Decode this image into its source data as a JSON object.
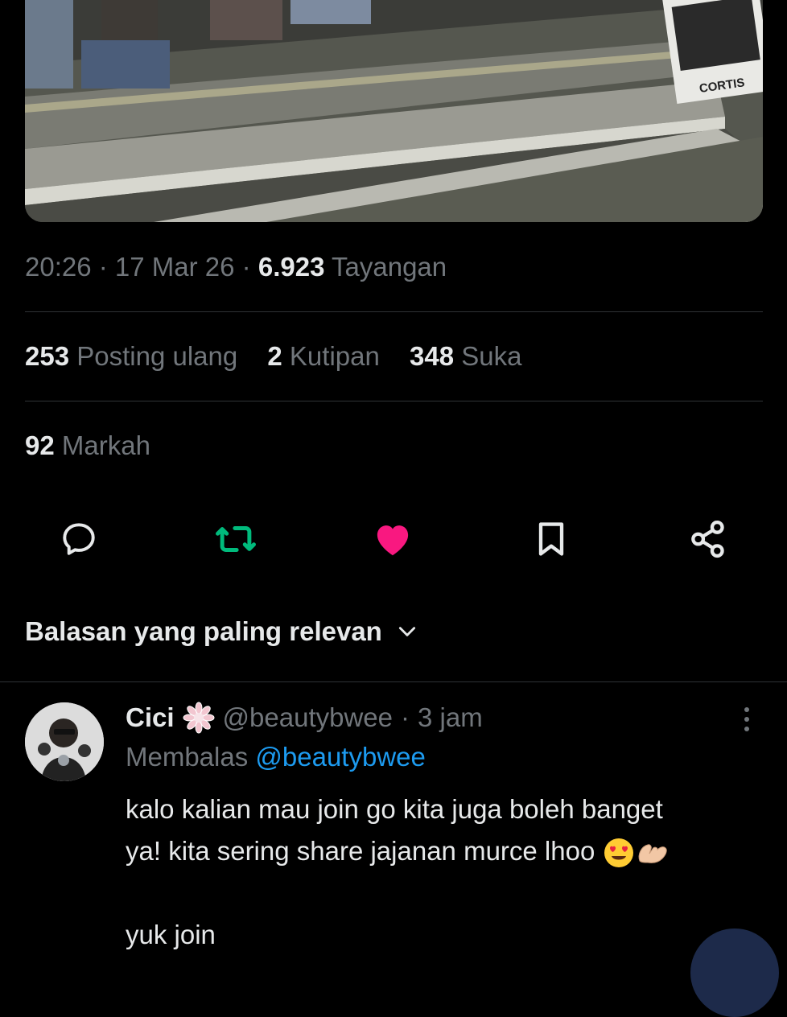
{
  "media": {
    "sign_text": "CORTIS"
  },
  "tweet_meta": {
    "time": "20:26",
    "sep1": " · ",
    "date": "17 Mar 26",
    "sep2": " · ",
    "views_count": "6.923",
    "views_label": " Tayangan"
  },
  "stats": {
    "reposts_count": "253",
    "reposts_label": " Posting ulang",
    "quotes_count": "2",
    "quotes_label": " Kutipan",
    "likes_count": "348",
    "likes_label": " Suka",
    "bookmarks_count": "92",
    "bookmarks_label": " Markah"
  },
  "actions": {
    "reply_icon": "reply-icon",
    "repost_icon": "repost-icon",
    "like_icon": "like-icon",
    "bookmark_icon": "bookmark-icon",
    "share_icon": "share-icon",
    "repost_color": "#00ba7c",
    "like_color": "#f91880"
  },
  "sort": {
    "label": "Balasan yang paling relevan"
  },
  "reply": {
    "name": "Cici",
    "badge_icon": "flower-badge-icon",
    "handle": "@beautybwee",
    "separator": "·",
    "time": "3 jam",
    "replying_label": "Membalas ",
    "replying_to": "@beautybwee",
    "body_line1": "kalo kalian mau join go kita juga boleh banget",
    "body_line2": "ya! kita sering share jajanan murce lhoo ",
    "body_line3": "yuk join",
    "emoji1": "smiling-face-heart-eyes-icon",
    "emoji2": "heart-hands-icon"
  },
  "colors": {
    "background": "#000000",
    "text": "#e7e9ea",
    "muted": "#71767b",
    "link": "#1d9bf0",
    "divider": "#2f3336"
  }
}
